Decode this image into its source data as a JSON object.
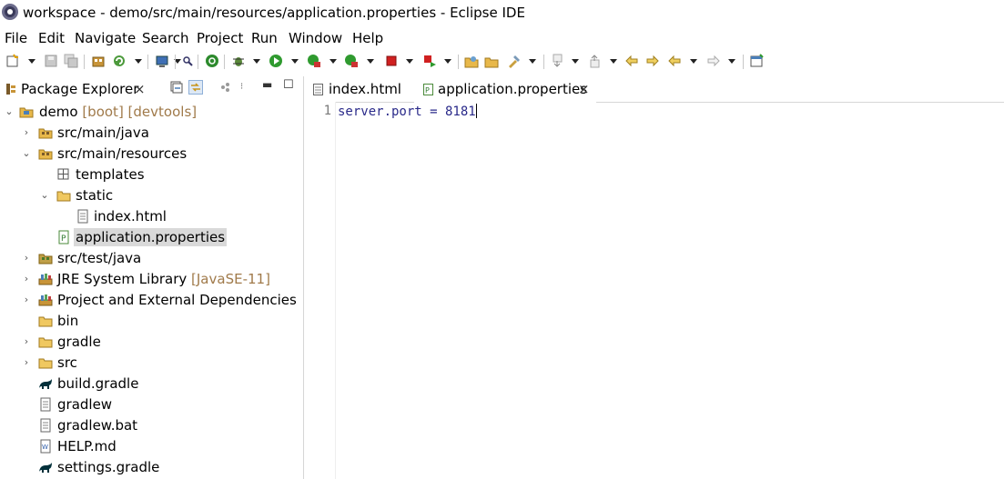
{
  "window": {
    "title": "workspace - demo/src/main/resources/application.properties - Eclipse IDE"
  },
  "menu": [
    "File",
    "Edit",
    "Navigate",
    "Search",
    "Project",
    "Run",
    "Window",
    "Help"
  ],
  "package_explorer": {
    "title": "Package Explorer",
    "close_glyph": "×",
    "minimize_glyph": "▬",
    "maximize_glyph": "☐"
  },
  "tree": [
    {
      "label": "demo",
      "decoration": "[boot] [devtools]",
      "icon": "project-icon",
      "twisty": "expanded"
    },
    {
      "label": "src/main/java",
      "icon": "source-folder-icon",
      "twisty": "collapsed"
    },
    {
      "label": "src/main/resources",
      "icon": "source-folder-icon",
      "twisty": "expanded"
    },
    {
      "label": "templates",
      "icon": "package-icon",
      "twisty": "none"
    },
    {
      "label": "static",
      "icon": "folder-icon",
      "twisty": "expanded"
    },
    {
      "label": "index.html",
      "icon": "file-icon",
      "twisty": "none"
    },
    {
      "label": "application.properties",
      "icon": "properties-file-icon",
      "twisty": "none",
      "selected": true
    },
    {
      "label": "src/test/java",
      "icon": "source-folder-icon",
      "twisty": "collapsed"
    },
    {
      "label": "JRE System Library",
      "decoration": "[JavaSE-11]",
      "icon": "library-icon",
      "twisty": "collapsed"
    },
    {
      "label": "Project and External Dependencies",
      "icon": "library-icon",
      "twisty": "collapsed"
    },
    {
      "label": "bin",
      "icon": "folder-icon",
      "twisty": "none"
    },
    {
      "label": "gradle",
      "icon": "folder-icon",
      "twisty": "collapsed"
    },
    {
      "label": "src",
      "icon": "folder-icon",
      "twisty": "collapsed"
    },
    {
      "label": "build.gradle",
      "icon": "gradle-icon",
      "twisty": "none"
    },
    {
      "label": "gradlew",
      "icon": "file-icon",
      "twisty": "none"
    },
    {
      "label": "gradlew.bat",
      "icon": "file-icon",
      "twisty": "none"
    },
    {
      "label": "HELP.md",
      "icon": "markdown-file-icon",
      "twisty": "none"
    },
    {
      "label": "settings.gradle",
      "icon": "gradle-icon",
      "twisty": "none"
    }
  ],
  "editor": {
    "tabs": [
      {
        "label": "index.html",
        "icon": "file-icon"
      },
      {
        "label": "application.properties",
        "icon": "properties-file-icon",
        "active": true,
        "close_glyph": "×"
      }
    ],
    "line_number": "1",
    "code": "server.port = 8181"
  },
  "colors": {
    "decoration": "#a07a4a",
    "selection": "#d9d9d9",
    "code_text": "#2a2a8a"
  }
}
